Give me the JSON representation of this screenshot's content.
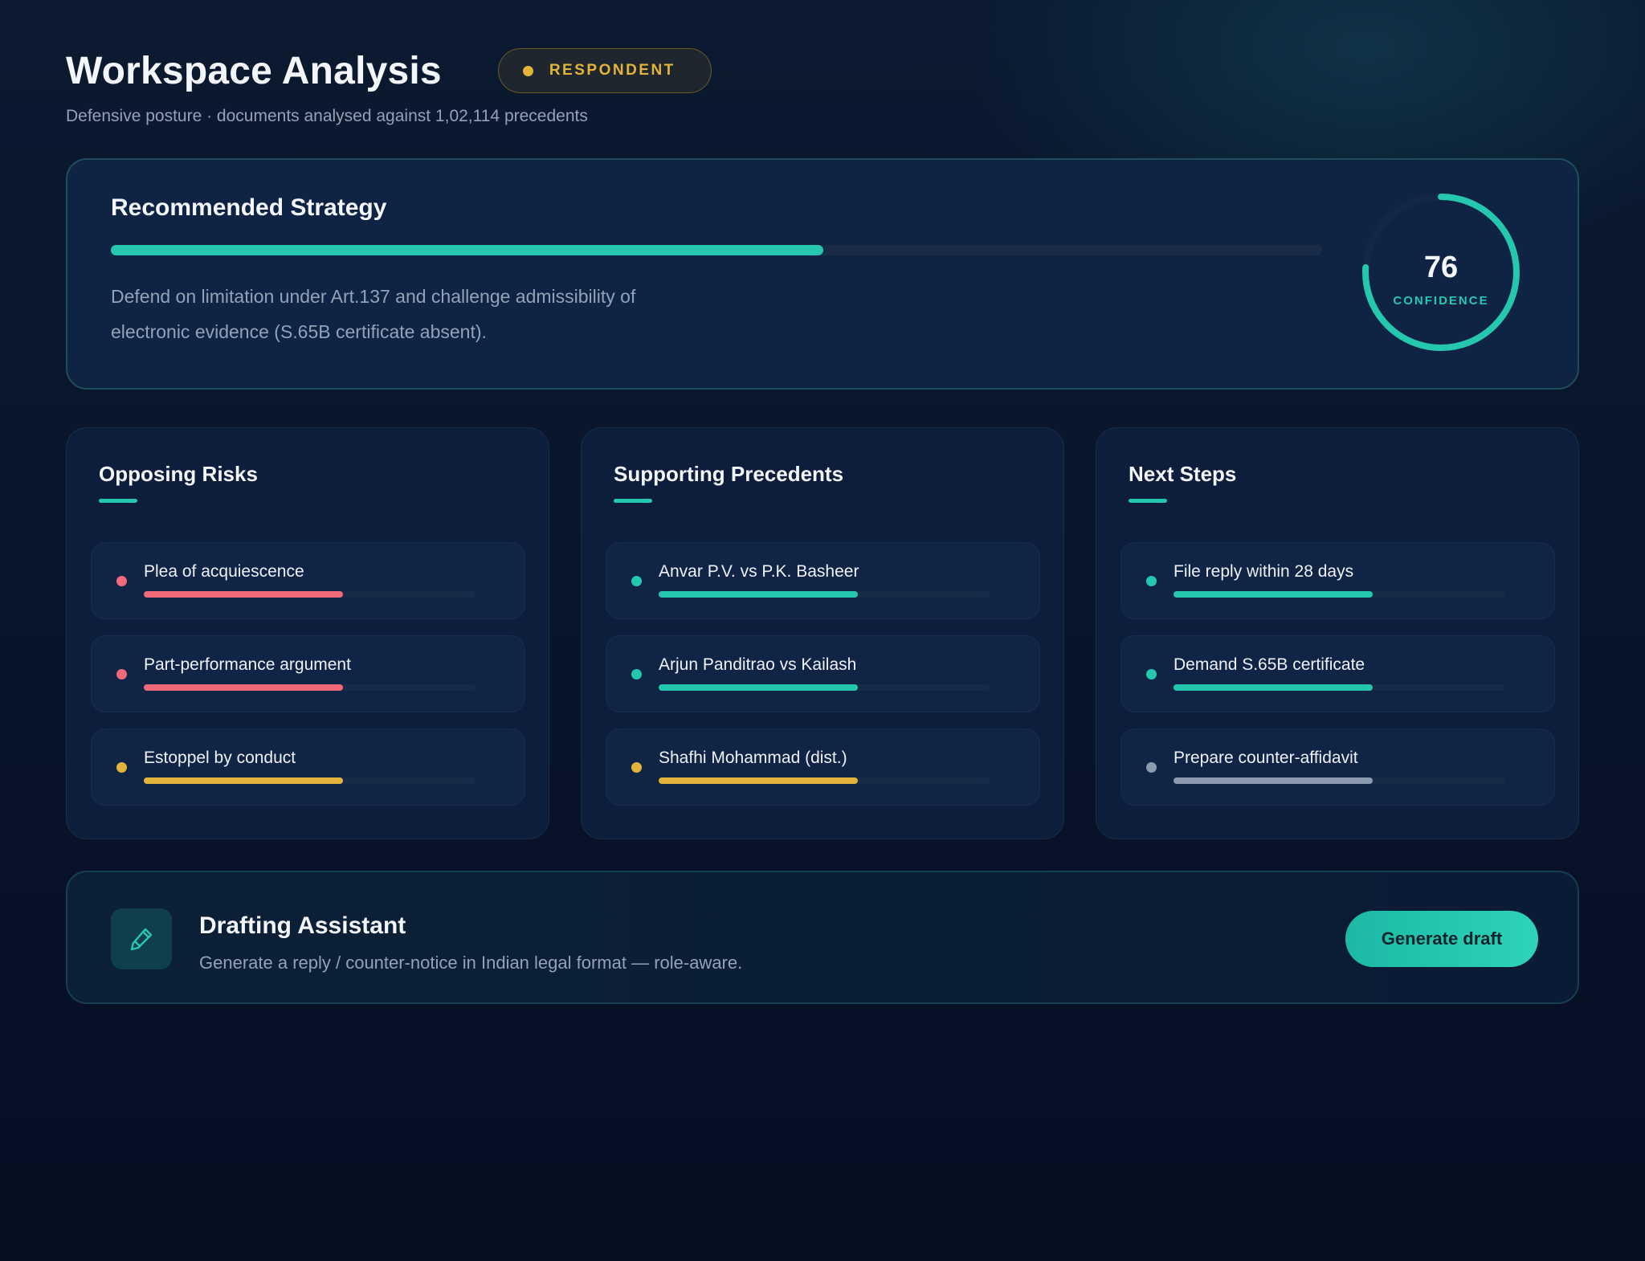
{
  "header": {
    "title": "Workspace Analysis",
    "role_badge": "RESPONDENT",
    "subtitle": "Defensive posture · documents analysed against 1,02,114 precedents"
  },
  "strategy": {
    "title": "Recommended Strategy",
    "progress": 0.588,
    "text": "Defend on limitation under Art.137 and challenge admissibility of electronic evidence (S.65B certificate absent).",
    "confidence": "76",
    "confidence_label": "CONFIDENCE",
    "confidence_fraction": 0.76
  },
  "columns": [
    {
      "title": "Opposing Risks",
      "items": [
        {
          "label": "Plea of acquiescence",
          "level": 0.6,
          "color": "#f06a7c"
        },
        {
          "label": "Part-performance argument",
          "level": 0.6,
          "color": "#f06a7c"
        },
        {
          "label": "Estoppel by conduct",
          "level": 0.6,
          "color": "#e2b53a"
        }
      ]
    },
    {
      "title": "Supporting Precedents",
      "items": [
        {
          "label": "Anvar P.V. vs P.K. Basheer",
          "level": 0.6,
          "color": "#25c8ae"
        },
        {
          "label": "Arjun Panditrao vs Kailash",
          "level": 0.6,
          "color": "#25c8ae"
        },
        {
          "label": "Shafhi Mohammad (dist.)",
          "level": 0.6,
          "color": "#e2b53a"
        }
      ]
    },
    {
      "title": "Next Steps",
      "items": [
        {
          "label": "File reply within 28 days",
          "level": 0.6,
          "color": "#25c8ae"
        },
        {
          "label": "Demand S.65B certificate",
          "level": 0.6,
          "color": "#25c8ae"
        },
        {
          "label": "Prepare counter-affidavit",
          "level": 0.6,
          "color": "#8c9ab0"
        }
      ]
    }
  ],
  "drafting": {
    "icon": "pencil-icon",
    "title": "Drafting Assistant",
    "text": "Generate a reply / counter-notice in Indian legal format — role-aware.",
    "button_label": "Generate draft"
  },
  "colors": {
    "accent": "#25c8ae",
    "warning": "#e2b53a",
    "danger": "#f06a7c",
    "neutral": "#8c9ab0"
  }
}
